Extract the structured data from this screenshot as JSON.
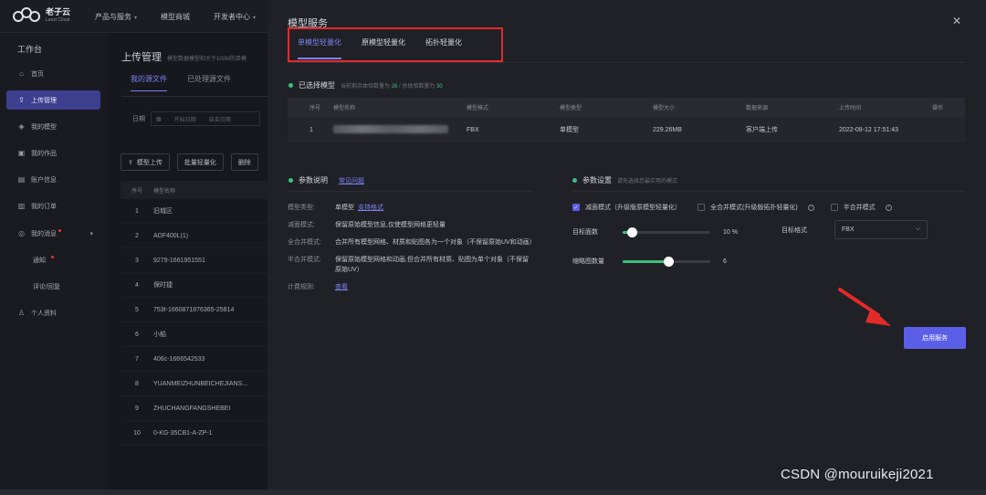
{
  "header": {
    "logo_cn": "老子云",
    "logo_en": "Laozi Cloud",
    "nav": [
      {
        "label": "产品与服务",
        "has_dropdown": true
      },
      {
        "label": "模型商城",
        "has_dropdown": false
      },
      {
        "label": "开发者中心",
        "has_dropdown": true
      }
    ]
  },
  "sidebar": {
    "title": "工作台",
    "items": [
      {
        "label": "首页",
        "icon": "home-icon"
      },
      {
        "label": "上传管理",
        "icon": "upload-icon",
        "active": true
      },
      {
        "label": "我的模型",
        "icon": "cube-icon"
      },
      {
        "label": "我的作品",
        "icon": "works-icon"
      },
      {
        "label": "账户信息",
        "icon": "account-icon"
      },
      {
        "label": "我的订单",
        "icon": "order-icon"
      },
      {
        "label": "我的消息",
        "icon": "message-icon",
        "expanded": true
      },
      {
        "label": "通知",
        "badge_dot": true
      },
      {
        "label": "评论/回复"
      },
      {
        "label": "个人资料",
        "icon": "user-icon"
      }
    ]
  },
  "main": {
    "title": "上传管理",
    "subtitle": "模型数据模型和大于100M的单模",
    "tabs": [
      "我的源文件",
      "已处理源文件"
    ],
    "date_label": "日期",
    "date_start_placeholder": "开始日期",
    "date_end_placeholder": "结束日期",
    "buttons": [
      "模型上传",
      "批量轻量化",
      "删除"
    ],
    "table_headers": [
      "序号",
      "模型名称"
    ],
    "rows": [
      {
        "no": "1",
        "name": "旧城区"
      },
      {
        "no": "2",
        "name": "ADF400L(1)"
      },
      {
        "no": "3",
        "name": "9279-1661951551"
      },
      {
        "no": "4",
        "name": "保时捷"
      },
      {
        "no": "5",
        "name": "753f-1660871876365-25814"
      },
      {
        "no": "6",
        "name": "小船"
      },
      {
        "no": "7",
        "name": "406c-1666542533"
      },
      {
        "no": "8",
        "name": "YUANMEIZHUNBEICHEJIANS..."
      },
      {
        "no": "9",
        "name": "ZHUCHANGFANGSHEBEI"
      },
      {
        "no": "10",
        "name": "0-KG-35CB1-A-ZP-1"
      }
    ]
  },
  "modal": {
    "title": "模型服务",
    "tabs": [
      "单模型轻量化",
      "原模型轻量化",
      "拓扑轻量化"
    ],
    "selected": {
      "heading": "已选择模型",
      "note_prefix": "当前剩余体验数量为",
      "remaining": "26",
      "note_mid": "/ 总体验数量为",
      "total": "30",
      "headers": [
        "序号",
        "模型名称",
        "模型格式",
        "模型类型",
        "模型大小",
        "数据来源",
        "上传时间",
        "操作"
      ],
      "row": {
        "no": "1",
        "format": "FBX",
        "type": "单模型",
        "size": "229.26MB",
        "source": "客户端上传",
        "time": "2022-08-12 17:51:43"
      }
    },
    "params": {
      "heading": "参数说明",
      "link": "常见问题",
      "model_type_label": "模型类型:",
      "model_type_value": "单模型",
      "model_type_link": "支持格式",
      "reduce_label": "减面模式:",
      "reduce_value": "保留原始模型信息,仅使模型网格更轻量",
      "full_merge_label": "全合并模式:",
      "full_merge_value": "合并所有模型网格、材质和贴图各为一个对象（不保留原始UV和动画）",
      "half_merge_label": "半合并模式:",
      "half_merge_value": "保留原始模型网格和动画,但合并所有材质、贴图为单个对象（不保留原始UV）",
      "billing_label": "计费规则:",
      "billing_link": "查看"
    },
    "settings": {
      "heading": "参数设置",
      "subheading": "请先选择您最实用的模式",
      "modes": [
        {
          "label": "减面模式（升级版原模型轻量化）",
          "checked": true,
          "help": false
        },
        {
          "label": "全合并模式(升级版拓扑轻量化)",
          "checked": false,
          "help": true
        },
        {
          "label": "半合并模式",
          "checked": false,
          "help": true
        }
      ],
      "target_faces_label": "目标面数",
      "target_faces_value": "10 %",
      "target_faces_fraction": 0.1,
      "format_label": "目标格式",
      "format_value": "FBX",
      "thumbs_label": "缩略图数量",
      "thumbs_value": "6",
      "thumbs_fraction": 0.52
    },
    "start_button": "启用服务"
  },
  "watermark": "CSDN @mouruikeji2021",
  "colors": {
    "accent": "#5b5fe8",
    "accent_text": "#7c80f0",
    "success": "#3fbf7f",
    "highlight_red": "#e32a2a"
  }
}
